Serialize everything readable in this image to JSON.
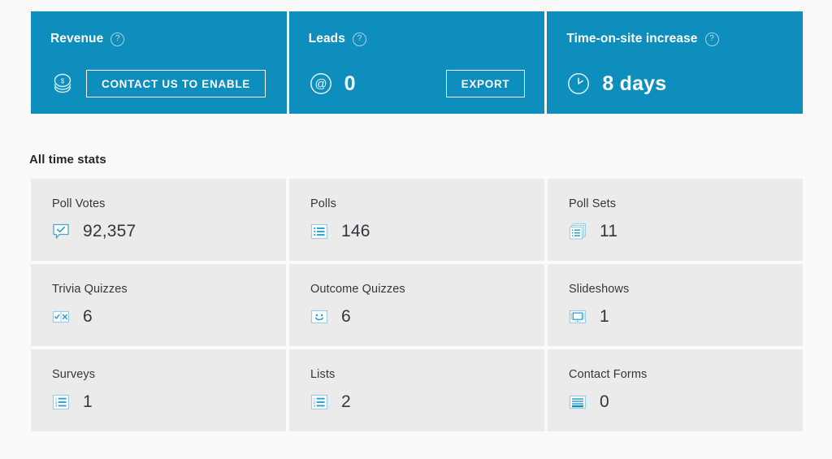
{
  "colors": {
    "accent_blue": "#0d8ebd",
    "page_background": "#fafafa",
    "stat_cell_background": "#ebebeb",
    "icon_blue": "#2e9fd2",
    "text_dark": "#32373c"
  },
  "highlights": [
    {
      "title": "Revenue",
      "help_label": "?",
      "icon": "coins-stack-icon",
      "value": "",
      "button": "CONTACT US TO ENABLE",
      "button_position": "inline"
    },
    {
      "title": "Leads",
      "help_label": "?",
      "icon": "at-sign-circle-icon",
      "value": "0",
      "button": "EXPORT",
      "button_position": "right"
    },
    {
      "title": "Time-on-site increase",
      "help_label": "?",
      "icon": "clock-icon",
      "value": "8 days",
      "button": "",
      "button_position": ""
    }
  ],
  "all_time_stats": {
    "heading": "All time stats",
    "items": [
      {
        "label": "Poll Votes",
        "value": "92,357",
        "icon": "speech-bubble-check-icon"
      },
      {
        "label": "Polls",
        "value": "146",
        "icon": "bullet-list-icon"
      },
      {
        "label": "Poll Sets",
        "value": "11",
        "icon": "stacked-lists-icon"
      },
      {
        "label": "Trivia Quizzes",
        "value": "6",
        "icon": "check-cross-icon"
      },
      {
        "label": "Outcome Quizzes",
        "value": "6",
        "icon": "smiley-face-icon"
      },
      {
        "label": "Slideshows",
        "value": "1",
        "icon": "slideshow-carousel-icon"
      },
      {
        "label": "Surveys",
        "value": "1",
        "icon": "numbered-list-icon"
      },
      {
        "label": "Lists",
        "value": "2",
        "icon": "numbered-list-icon"
      },
      {
        "label": "Contact Forms",
        "value": "0",
        "icon": "contact-form-icon"
      }
    ]
  }
}
